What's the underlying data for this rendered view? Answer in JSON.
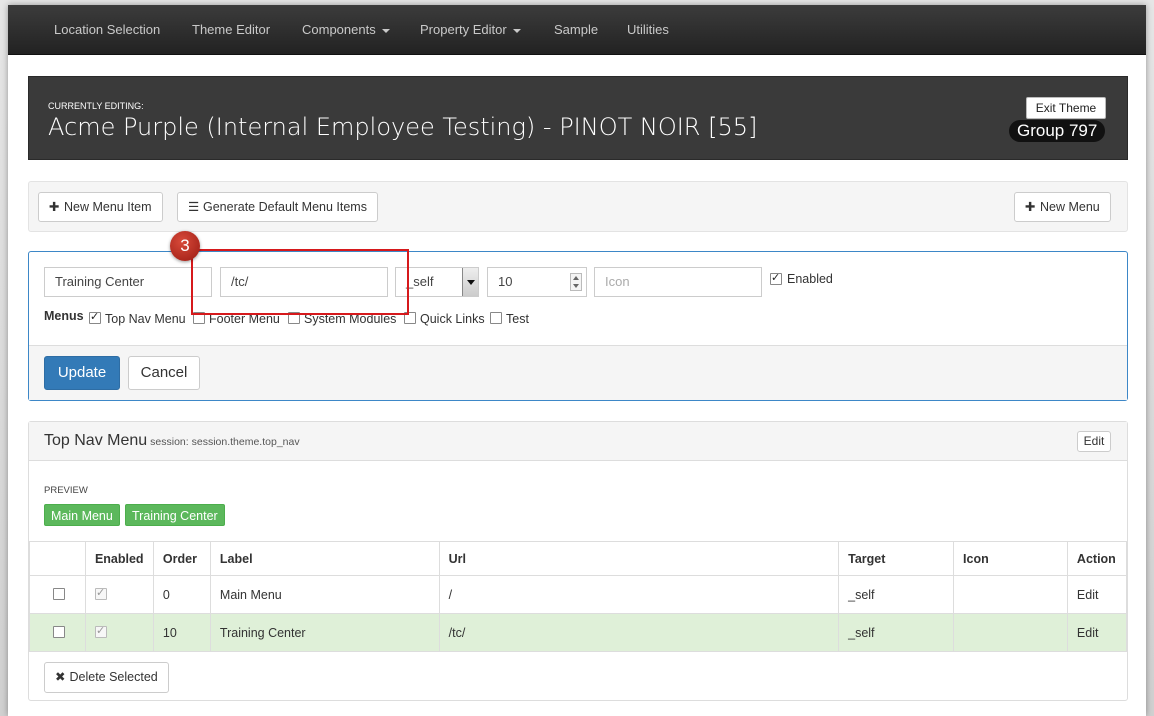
{
  "navbar": {
    "items": [
      {
        "label": "Location Selection",
        "dropdown": false
      },
      {
        "label": "Theme Editor",
        "dropdown": false
      },
      {
        "label": "Components",
        "dropdown": true
      },
      {
        "label": "Property Editor",
        "dropdown": true
      },
      {
        "label": "Sample",
        "dropdown": false
      },
      {
        "label": "Utilities",
        "dropdown": false
      }
    ]
  },
  "banner": {
    "small_label": "CURRENTLY EDITING:",
    "title": "Acme Purple (Internal Employee Testing) - PINOT NOIR [55]",
    "exit_label": "Exit Theme",
    "group_label": "Group 797"
  },
  "toolbar": {
    "new_menu_item": "New Menu Item",
    "generate_default": "Generate Default Menu Items",
    "new_menu": "New Menu"
  },
  "edit_form": {
    "label_value": "Training Center",
    "url_value": "/tc/",
    "target_value": "_self",
    "order_value": "10",
    "icon_placeholder": "Icon",
    "enabled_label": "Enabled",
    "enabled_checked": true,
    "menus_label": "Menus",
    "menus": [
      {
        "label": "Top Nav Menu",
        "checked": true
      },
      {
        "label": "Footer Menu",
        "checked": false
      },
      {
        "label": "System Modules",
        "checked": false
      },
      {
        "label": "Quick Links",
        "checked": false
      },
      {
        "label": "Test",
        "checked": false
      }
    ],
    "update_label": "Update",
    "cancel_label": "Cancel"
  },
  "annotation": {
    "step_number": "3",
    "color": "#d6191c"
  },
  "menu_panel": {
    "title": "Top Nav Menu",
    "session": "session: session.theme.top_nav",
    "edit_label": "Edit",
    "preview_label": "PREVIEW",
    "preview_items": [
      "Main Menu",
      "Training Center"
    ],
    "columns": [
      "",
      "Enabled",
      "Order",
      "Label",
      "Url",
      "Target",
      "Icon",
      "Action"
    ],
    "rows": [
      {
        "enabled": true,
        "order": "0",
        "label": "Main Menu",
        "url": "/",
        "target": "_self",
        "icon": "",
        "action": "Edit",
        "highlighted": false
      },
      {
        "enabled": true,
        "order": "10",
        "label": "Training Center",
        "url": "/tc/",
        "target": "_self",
        "icon": "",
        "action": "Edit",
        "highlighted": true
      }
    ],
    "delete_label": "Delete Selected"
  },
  "colors": {
    "primary": "#337ab7",
    "success": "#5cb85c",
    "row_highlight": "#dff0d8",
    "navbar": "#222222"
  }
}
